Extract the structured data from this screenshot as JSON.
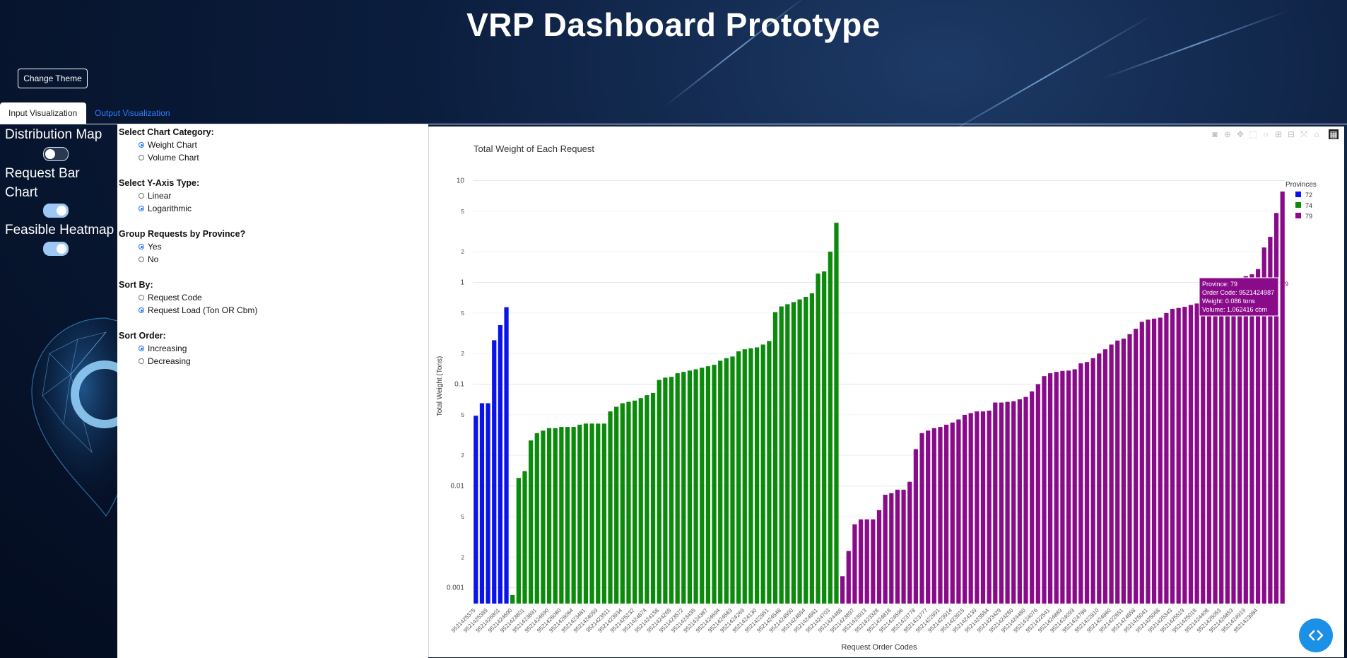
{
  "header": {
    "title": "VRP Dashboard Prototype",
    "theme_button": "Change Theme"
  },
  "tabs": [
    {
      "label": "Input Visualization",
      "active": true
    },
    {
      "label": "Output Visualization",
      "active": false
    }
  ],
  "toggles": [
    {
      "label": "Distribution Map",
      "on": false
    },
    {
      "label": "Request Bar Chart",
      "on": true
    },
    {
      "label": "Feasible Heatmap",
      "on": true
    }
  ],
  "controls": {
    "chart_category": {
      "title": "Select Chart Category:",
      "options": [
        "Weight Chart",
        "Volume Chart"
      ],
      "selected": "Weight Chart"
    },
    "y_axis_type": {
      "title": "Select Y-Axis Type:",
      "options": [
        "Linear",
        "Logarithmic"
      ],
      "selected": "Logarithmic"
    },
    "group_by_province": {
      "title": "Group Requests by Province?",
      "options": [
        "Yes",
        "No"
      ],
      "selected": "Yes"
    },
    "sort_by": {
      "title": "Sort By:",
      "options": [
        "Request Code",
        "Request Load (Ton OR Cbm)"
      ],
      "selected": "Request Load (Ton OR Cbm)"
    },
    "sort_order": {
      "title": "Sort Order:",
      "options": [
        "Increasing",
        "Decreasing"
      ],
      "selected": "Increasing"
    }
  },
  "colors": {
    "province_72": "#0a14e6",
    "province_74": "#0b8a0b",
    "province_79": "#8a0b8a",
    "accent": "#1a73e8"
  },
  "modebar_icons": [
    "camera-icon",
    "zoom-icon",
    "pan-icon",
    "box-select-icon",
    "lasso-icon",
    "zoom-in-icon",
    "zoom-out-icon",
    "autoscale-icon",
    "home-icon",
    "plotly-logo-icon"
  ],
  "chart_data": {
    "type": "bar",
    "title": "Total Weight of Each Request",
    "xlabel": "Request Order Codes",
    "ylabel": "Total Weight (Tons)",
    "yscale": "log",
    "ylim": [
      0.0007,
      13
    ],
    "y_ticks": [
      {
        "value": 0.001,
        "label": "0.001"
      },
      {
        "value": 0.002,
        "label": "2"
      },
      {
        "value": 0.005,
        "label": "5"
      },
      {
        "value": 0.01,
        "label": "0.01"
      },
      {
        "value": 0.02,
        "label": "2"
      },
      {
        "value": 0.05,
        "label": "5"
      },
      {
        "value": 0.1,
        "label": "0.1"
      },
      {
        "value": 0.2,
        "label": "2"
      },
      {
        "value": 0.5,
        "label": "5"
      },
      {
        "value": 1,
        "label": "1"
      },
      {
        "value": 2,
        "label": "2"
      },
      {
        "value": 5,
        "label": "5"
      },
      {
        "value": 10,
        "label": "10"
      }
    ],
    "legend": {
      "title": "Provinces",
      "placement": "top-right",
      "entries": [
        "72",
        "74",
        "79"
      ]
    },
    "x_tick_labels": [
      "9521425375",
      "9521425389",
      "9521426801",
      "9521424690",
      "9521423801",
      "9521423891",
      "9521424690",
      "9521426080",
      "9521426084",
      "9521423481",
      "9521424059",
      "9521423511",
      "9521423934",
      "9521425232",
      "9521424874",
      "9521424158",
      "9521424265",
      "9521423572",
      "9521423435",
      "9521424387",
      "9521424694",
      "9521424583",
      "9521424269",
      "9521424130",
      "9521422851",
      "9521424548",
      "9521424500",
      "9521424854",
      "9521424861",
      "9521424703",
      "9521424488",
      "9521423897",
      "9521423913",
      "9521423328",
      "9521424818",
      "9521424596",
      "9521423778",
      "9521423777",
      "9521422691",
      "9521423914",
      "9521423915",
      "9521424139",
      "9521423554",
      "9521423429",
      "9521424280",
      "9521424480",
      "9521424076",
      "9521422541",
      "9521424889",
      "9521424093",
      "9521424786",
      "9521422810",
      "9521424860",
      "9521422651",
      "9521424858",
      "9521425041",
      "9521425068",
      "9521425343",
      "9521425519",
      "9521425018",
      "9521424408",
      "9521425053",
      "9521424853",
      "9521424919",
      "9521423984"
    ],
    "series": [
      {
        "name": "72",
        "values": [
          0.049,
          0.065,
          0.065,
          0.27,
          0.38,
          0.57
        ]
      },
      {
        "name": "74",
        "values": [
          0.00085,
          0.012,
          0.014,
          0.028,
          0.033,
          0.035,
          0.037,
          0.037,
          0.038,
          0.038,
          0.038,
          0.04,
          0.041,
          0.041,
          0.041,
          0.041,
          0.054,
          0.06,
          0.065,
          0.067,
          0.069,
          0.073,
          0.078,
          0.082,
          0.11,
          0.116,
          0.118,
          0.128,
          0.132,
          0.136,
          0.14,
          0.145,
          0.15,
          0.155,
          0.17,
          0.18,
          0.187,
          0.21,
          0.22,
          0.225,
          0.23,
          0.245,
          0.265,
          0.51,
          0.58,
          0.61,
          0.64,
          0.68,
          0.72,
          0.78,
          1.22,
          1.28,
          2.0,
          3.85
        ]
      },
      {
        "name": "79",
        "values": [
          0.0013,
          0.0023,
          0.0042,
          0.0047,
          0.0047,
          0.0047,
          0.0058,
          0.0082,
          0.0085,
          0.0092,
          0.0092,
          0.011,
          0.023,
          0.033,
          0.035,
          0.037,
          0.038,
          0.04,
          0.042,
          0.045,
          0.05,
          0.052,
          0.054,
          0.054,
          0.055,
          0.066,
          0.066,
          0.067,
          0.068,
          0.071,
          0.075,
          0.085,
          0.1,
          0.12,
          0.128,
          0.132,
          0.135,
          0.136,
          0.14,
          0.16,
          0.165,
          0.18,
          0.2,
          0.22,
          0.245,
          0.268,
          0.28,
          0.31,
          0.35,
          0.41,
          0.43,
          0.44,
          0.45,
          0.5,
          0.55,
          0.56,
          0.575,
          0.6,
          0.62,
          0.65,
          0.7,
          0.72,
          0.8,
          0.85,
          0.9,
          1.0,
          1.15,
          1.2,
          1.35,
          2.2,
          2.8,
          4.8,
          7.8
        ]
      }
    ],
    "hover": {
      "lines": [
        "Province: 79",
        "Order Code: 9521424987",
        "Weight: 0.086 tons",
        "Volume: 1.062416 cbm"
      ],
      "tag": "79"
    }
  }
}
